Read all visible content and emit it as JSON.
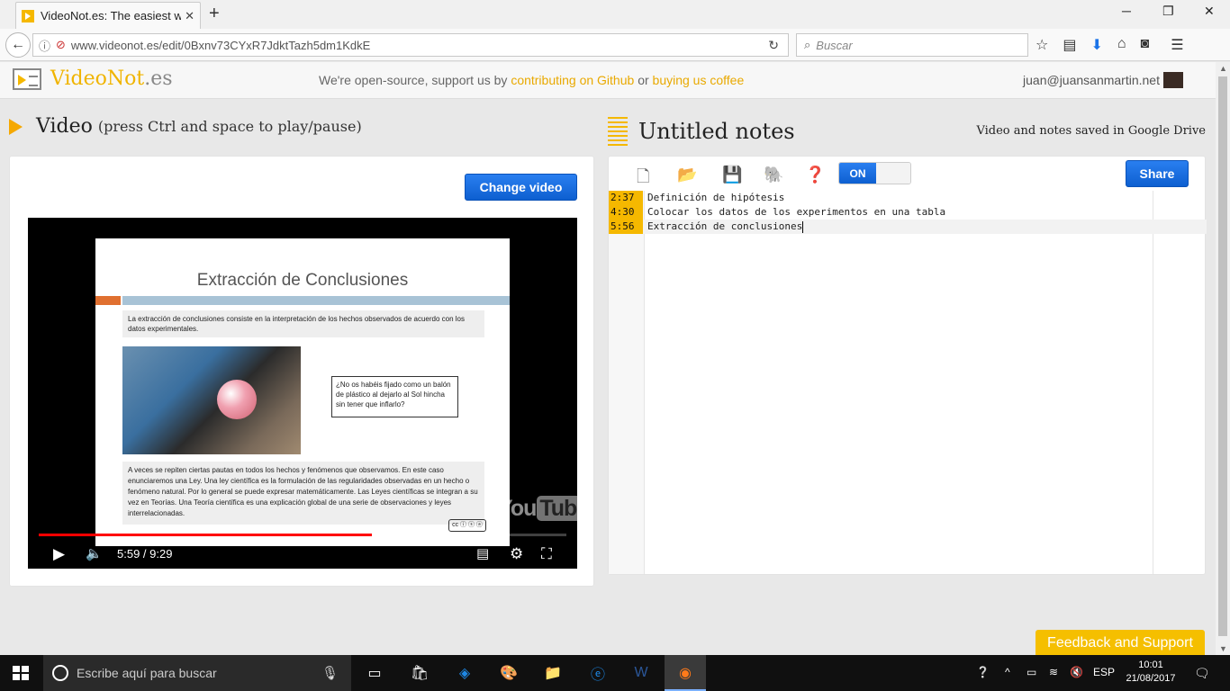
{
  "browser": {
    "tab_title": "VideoNot.es: The easiest way",
    "tab_close": "✕",
    "new_tab": "+",
    "url": "www.videonot.es/edit/0Bxnv73CYxR7JdktTazh5dm1KdkE",
    "search_placeholder": "Buscar"
  },
  "app": {
    "logo_first": "VideoNot",
    "logo_second": ".es",
    "opensource_prefix": "We're open-source, support us by",
    "github_link": "contributing on Github",
    "or": "or",
    "coffee_link": "buying us coffee",
    "user_email": "juan@juansanmartin.net"
  },
  "video": {
    "title": "Video",
    "subtitle": "(press Ctrl and space to play/pause)",
    "change_button": "Change video",
    "current_time": "5:59",
    "duration": "9:29",
    "time_display": "5:59 / 9:29",
    "progress_fraction": 0.631,
    "slide": {
      "title": "Extracción de Conclusiones",
      "para1": "La extracción de conclusiones consiste en la interpretación de los hechos observados de acuerdo con los datos experimentales.",
      "quote": "¿No os habéis fijado como un balón de plástico al dejarlo al Sol hincha sin tener que inflarlo?",
      "para2": "A veces se repiten ciertas pautas en todos los hechos y fenómenos que observamos. En este caso enunciaremos una Ley. Una ley científica es la formulación de las regularidades observadas en un hecho o fenómeno natural. Por lo general se puede expresar matemáticamente. Las Leyes científicas se integran a su vez en Teorías. Una Teoría científica es una explicación global de una serie de observaciones y leyes interrelacionadas.",
      "cc": "cc ⓘ ⓢ ⓐ"
    },
    "yt_you": "You",
    "yt_tube": "Tube"
  },
  "notes": {
    "title": "Untitled notes",
    "saved_text": "Video and notes saved in Google Drive",
    "toggle_label": "ON",
    "share_button": "Share",
    "lines": [
      {
        "time": "2:37",
        "text": "Definición de hipótesis"
      },
      {
        "time": "4:30",
        "text": "Colocar los datos de los experimentos en una tabla"
      },
      {
        "time": "5:56",
        "text": "Extracción de conclusiones"
      }
    ]
  },
  "feedback_button": "Feedback and Support",
  "taskbar": {
    "search_placeholder": "Escribe aquí para buscar",
    "language": "ESP",
    "time": "10:01",
    "date": "21/08/2017"
  },
  "colors": {
    "accent_yellow": "#f5b800",
    "button_blue": "#0d5fd0",
    "progress_red": "#ff0000"
  }
}
